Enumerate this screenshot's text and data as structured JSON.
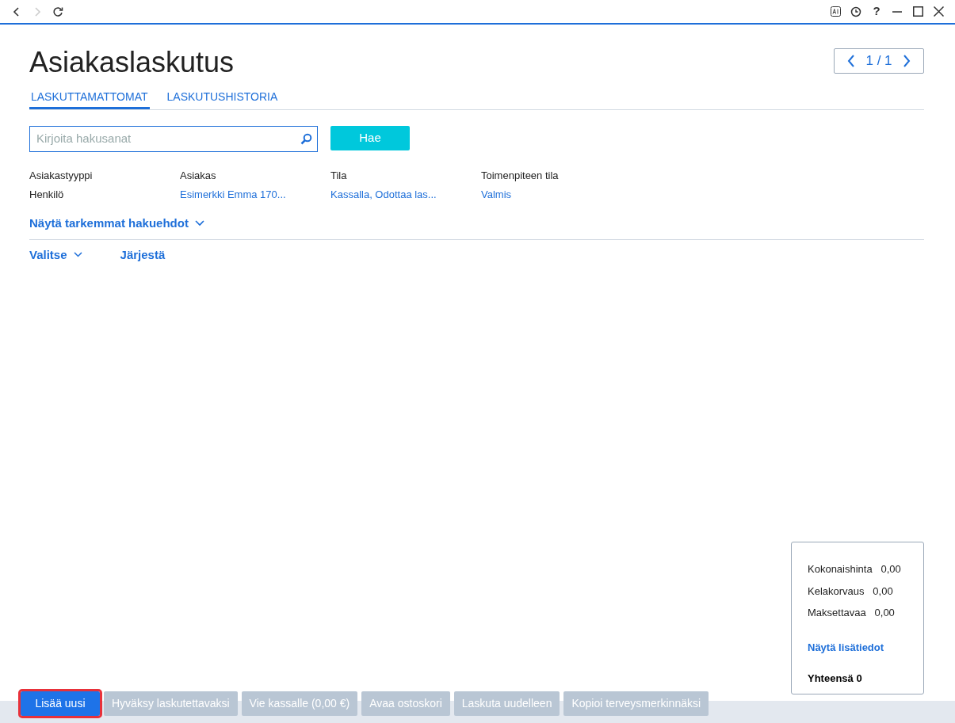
{
  "toolbar": {
    "back": {
      "disabled": false
    },
    "forward": {
      "disabled": true
    },
    "help": "?"
  },
  "page": {
    "title": "Asiakaslaskutus",
    "pager": "1 / 1"
  },
  "tabs": [
    {
      "label": "LASKUTTAMATTOMAT",
      "selected": true
    },
    {
      "label": "LASKUTUSHISTORIA",
      "selected": false
    }
  ],
  "search": {
    "placeholder": "Kirjoita hakusanat",
    "button": "Hae"
  },
  "filters": [
    {
      "label": "Asiakastyyppi",
      "value": "Henkilö",
      "link": false
    },
    {
      "label": "Asiakas",
      "value": "Esimerkki Emma 170...",
      "link": true
    },
    {
      "label": "Tila",
      "value": "Kassalla, Odottaa las...",
      "link": true
    },
    {
      "label": "Toimenpiteen tila",
      "value": "Valmis",
      "link": true
    }
  ],
  "more_filters": "Näytä tarkemmat hakuehdot",
  "list_actions": [
    {
      "label": "Valitse",
      "dropdown": true
    },
    {
      "label": "Järjestä",
      "dropdown": false
    }
  ],
  "summary": {
    "rows": [
      {
        "label": "Kokonaishinta",
        "value": "0,00"
      },
      {
        "label": "Kelakorvaus",
        "value": "0,00"
      },
      {
        "label": "Maksettavaa",
        "value": "0,00"
      }
    ],
    "details_link": "Näytä lisätiedot",
    "total": "Yhteensä 0"
  },
  "actions": [
    {
      "label": "Lisää uusi",
      "disabled": false,
      "highlighted": true
    },
    {
      "label": "Hyväksy laskutettavaksi",
      "disabled": true,
      "highlighted": false
    },
    {
      "label": "Vie kassalle (0,00 €)",
      "disabled": true,
      "highlighted": false
    },
    {
      "label": "Avaa ostoskori",
      "disabled": true,
      "highlighted": false
    },
    {
      "label": "Laskuta uudelleen",
      "disabled": true,
      "highlighted": false
    },
    {
      "label": "Kopioi terveysmerkinnäksi",
      "disabled": true,
      "highlighted": false
    }
  ]
}
